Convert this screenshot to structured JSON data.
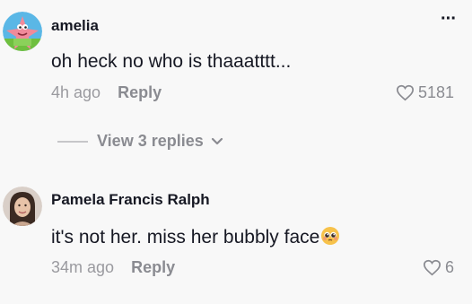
{
  "comments": [
    {
      "username": "amelia",
      "text": "oh heck no who is thaaatttt...",
      "time": "4h ago",
      "reply_label": "Reply",
      "likes": "5181",
      "avatar_icon": "patrick-star-avatar",
      "more_icon": "more-dots-icon"
    },
    {
      "username": "Pamela Francis Ralph",
      "text": "it's not her. miss her bubbly face",
      "emoji_icon": "pleading-face-emoji",
      "time": "34m ago",
      "reply_label": "Reply",
      "likes": "6",
      "avatar_icon": "user-photo-avatar"
    }
  ],
  "view_replies": {
    "label": "View 3 replies"
  },
  "colors": {
    "background": "#f8f8f8",
    "primary_text": "#161823",
    "secondary_text": "#8a8b91"
  }
}
